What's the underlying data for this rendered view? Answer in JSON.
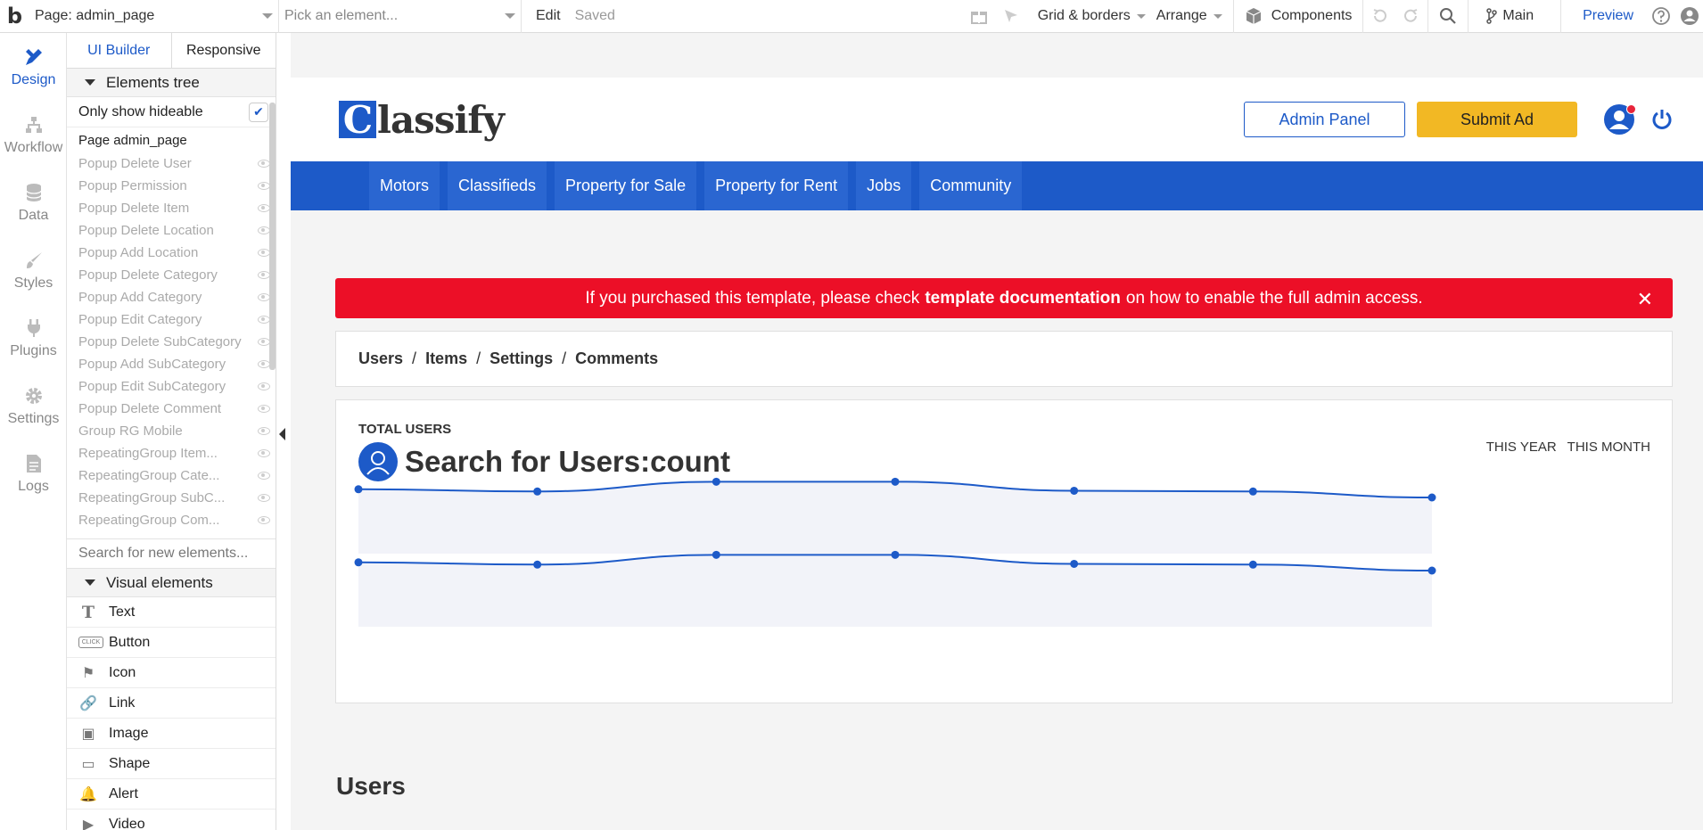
{
  "toolbar": {
    "logo": "b",
    "page_selector": "Page: admin_page",
    "element_picker": "Pick an element...",
    "edit": "Edit",
    "saved": "Saved",
    "grid_borders": "Grid & borders",
    "arrange": "Arrange",
    "components": "Components",
    "branch": "Main",
    "preview": "Preview"
  },
  "rail": {
    "items": [
      {
        "label": "Design",
        "icon": "design-icon"
      },
      {
        "label": "Workflow",
        "icon": "workflow-icon"
      },
      {
        "label": "Data",
        "icon": "data-icon"
      },
      {
        "label": "Styles",
        "icon": "styles-icon"
      },
      {
        "label": "Plugins",
        "icon": "plugins-icon"
      },
      {
        "label": "Settings",
        "icon": "settings-icon"
      },
      {
        "label": "Logs",
        "icon": "logs-icon"
      }
    ]
  },
  "panel": {
    "tabs": [
      "UI Builder",
      "Responsive"
    ],
    "elements_tree_title": "Elements tree",
    "only_show_hideable": "Only show hideable",
    "root": "Page admin_page",
    "tree_items": [
      "Popup Delete User",
      "Popup Permission",
      "Popup Delete Item",
      "Popup Delete Location",
      "Popup Add Location",
      "Popup Delete Category",
      "Popup Add Category",
      "Popup Edit Category",
      "Popup Delete SubCategory",
      "Popup Add SubCategory",
      "Popup Edit SubCategory",
      "Popup Delete Comment",
      "Group RG Mobile",
      "RepeatingGroup Item...",
      "RepeatingGroup Cate...",
      "RepeatingGroup SubC...",
      "RepeatingGroup Com..."
    ],
    "search_placeholder": "Search for new elements...",
    "visual_title": "Visual elements",
    "visual_items": [
      {
        "label": "Text",
        "icon": "text-icon",
        "glyph": "T"
      },
      {
        "label": "Button",
        "icon": "button-icon",
        "glyph": "CLICK"
      },
      {
        "label": "Icon",
        "icon": "flag-icon",
        "glyph": "⚑"
      },
      {
        "label": "Link",
        "icon": "link-icon",
        "glyph": "🔗"
      },
      {
        "label": "Image",
        "icon": "image-icon",
        "glyph": "▣"
      },
      {
        "label": "Shape",
        "icon": "shape-icon",
        "glyph": "▭"
      },
      {
        "label": "Alert",
        "icon": "bell-icon",
        "glyph": "🔔"
      },
      {
        "label": "Video",
        "icon": "video-icon",
        "glyph": "▶"
      }
    ]
  },
  "site": {
    "logo_initial": "C",
    "logo_rest": "lassify",
    "admin_panel": "Admin Panel",
    "submit_ad": "Submit Ad",
    "nav": [
      "Motors",
      "Classifieds",
      "Property for Sale",
      "Property for Rent",
      "Jobs",
      "Community"
    ],
    "alert": {
      "prefix": "If you purchased this template, please check",
      "bold": "template documentation",
      "suffix": "on how to enable the full admin access.",
      "close": "✕"
    },
    "breadcrumb": [
      "Users",
      "Items",
      "Settings",
      "Comments"
    ],
    "breadcrumb_sep": "/",
    "stats": {
      "label": "TOTAL USERS",
      "count": "Search for Users:count",
      "filters": [
        "THIS YEAR",
        "THIS MONTH"
      ]
    },
    "users_heading": "Users"
  },
  "colors": {
    "brand_blue": "#1d5ac8",
    "submit_yellow": "#f2b824",
    "alert_red": "#ec0f27",
    "chart_fill": "#f2f3f9"
  },
  "chart_data": [
    {
      "type": "line",
      "values": [
        86,
        83,
        96,
        96,
        84,
        83,
        75
      ]
    },
    {
      "type": "line",
      "values": [
        86,
        83,
        96,
        96,
        84,
        83,
        75
      ]
    }
  ]
}
